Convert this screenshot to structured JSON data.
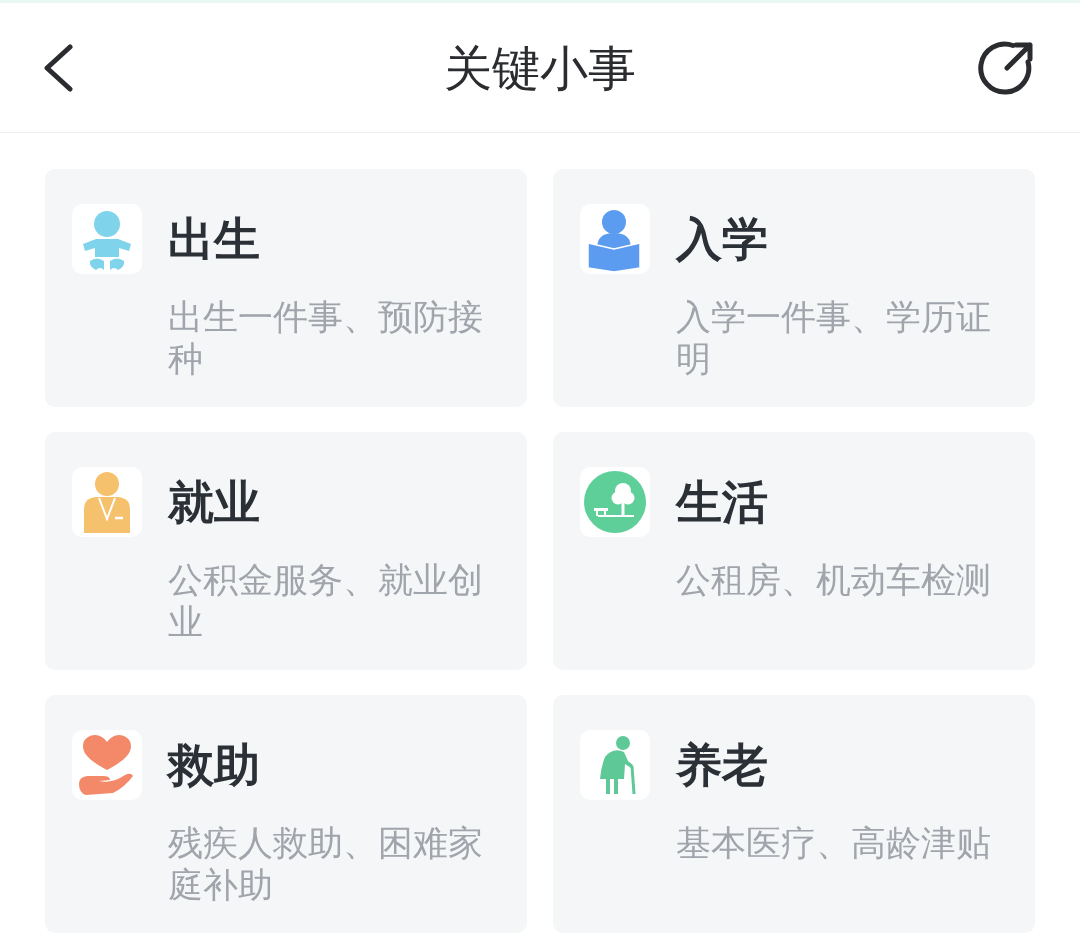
{
  "header": {
    "title": "关键小事"
  },
  "cards": [
    {
      "kind": "baby",
      "title": "出生",
      "description": "出生一件事、预防接种"
    },
    {
      "kind": "student",
      "title": "入学",
      "description": "入学一件事、学历证明"
    },
    {
      "kind": "worker",
      "title": "就业",
      "description": "公积金服务、就业创业"
    },
    {
      "kind": "park",
      "title": "生活",
      "description": "公租房、机动车检测"
    },
    {
      "kind": "aid",
      "title": "救助",
      "description": "残疾人救助、困难家庭补助"
    },
    {
      "kind": "elder",
      "title": "养老",
      "description": "基本医疗、高龄津贴"
    }
  ]
}
